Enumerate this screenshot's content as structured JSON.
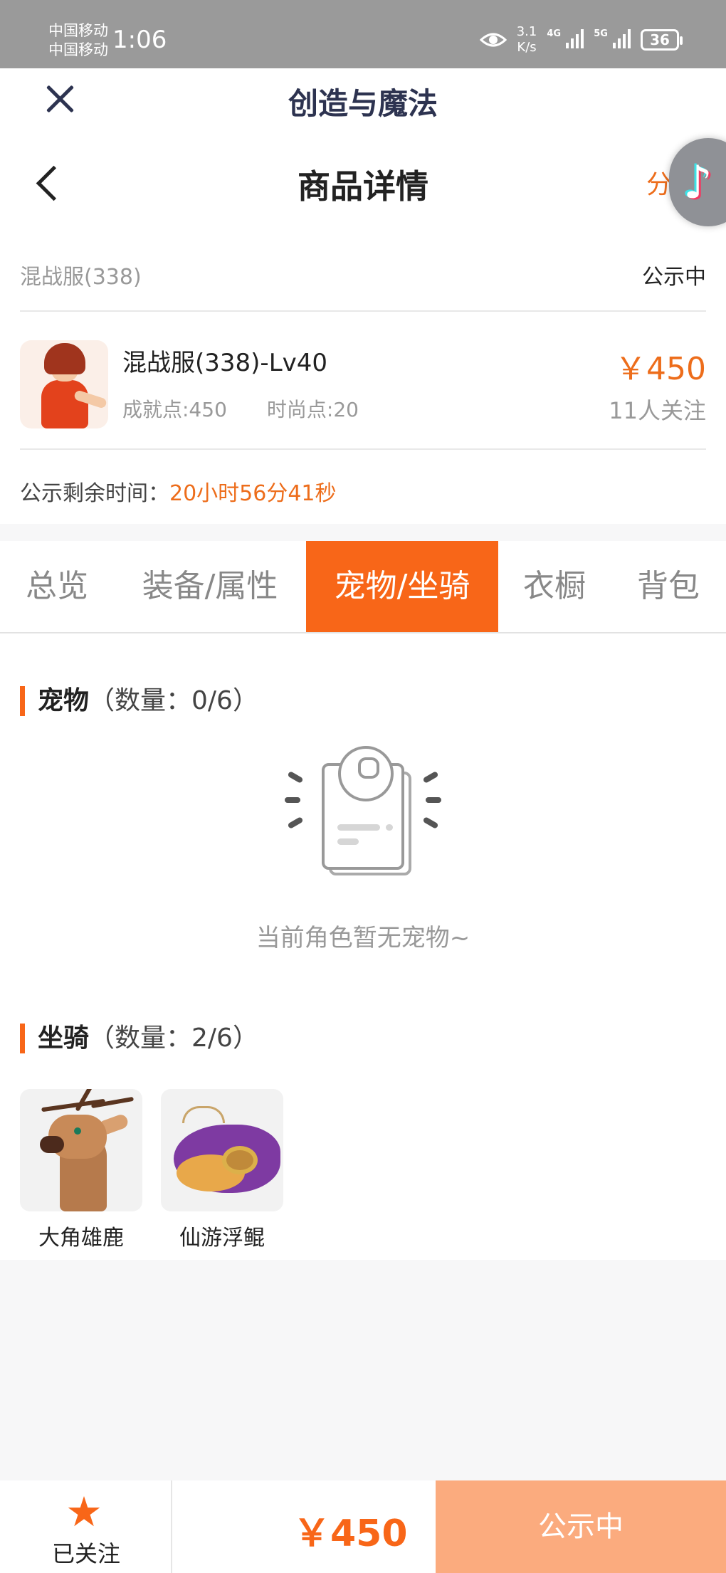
{
  "status_bar": {
    "carrier_1": "中国移动",
    "carrier_2": "中国移动",
    "time": "1:06",
    "speed_value": "3.1",
    "speed_unit": "K/s",
    "net_1": "4G",
    "net_2": "5G",
    "battery": "36"
  },
  "app_header": {
    "title": "创造与魔法"
  },
  "page_header": {
    "title": "商品详情",
    "share_label": "分享"
  },
  "product": {
    "server": "混战服(338)",
    "status": "公示中",
    "name": "混战服(338)-Lv40",
    "achievement": "成就点:450",
    "fashion": "时尚点:20",
    "price": "￥450",
    "followers": "11人关注",
    "remain_label": "公示剩余时间：",
    "remain_value": "20小时56分41秒"
  },
  "tabs": [
    {
      "label": "总览",
      "active": false
    },
    {
      "label": "装备/属性",
      "active": false
    },
    {
      "label": "宠物/坐骑",
      "active": true
    },
    {
      "label": "衣橱",
      "active": false
    },
    {
      "label": "背包",
      "active": false
    }
  ],
  "pets": {
    "title": "宠物",
    "count": "（数量：0/6）",
    "empty_text": "当前角色暂无宠物~"
  },
  "mounts": {
    "title": "坐骑",
    "count": "（数量：2/6）",
    "items": [
      {
        "name": "大角雄鹿",
        "icon": "deer-mount-icon"
      },
      {
        "name": "仙游浮鲲",
        "icon": "flying-fish-mount-icon"
      }
    ]
  },
  "bottom_bar": {
    "follow_label": "已关注",
    "star_icon": "★",
    "price": "￥450",
    "action_label": "公示中"
  },
  "colors": {
    "accent": "#f86618",
    "price": "#ed6d1b",
    "action_disabled": "#fbab7e",
    "status_bar": "#9a9a9a"
  }
}
